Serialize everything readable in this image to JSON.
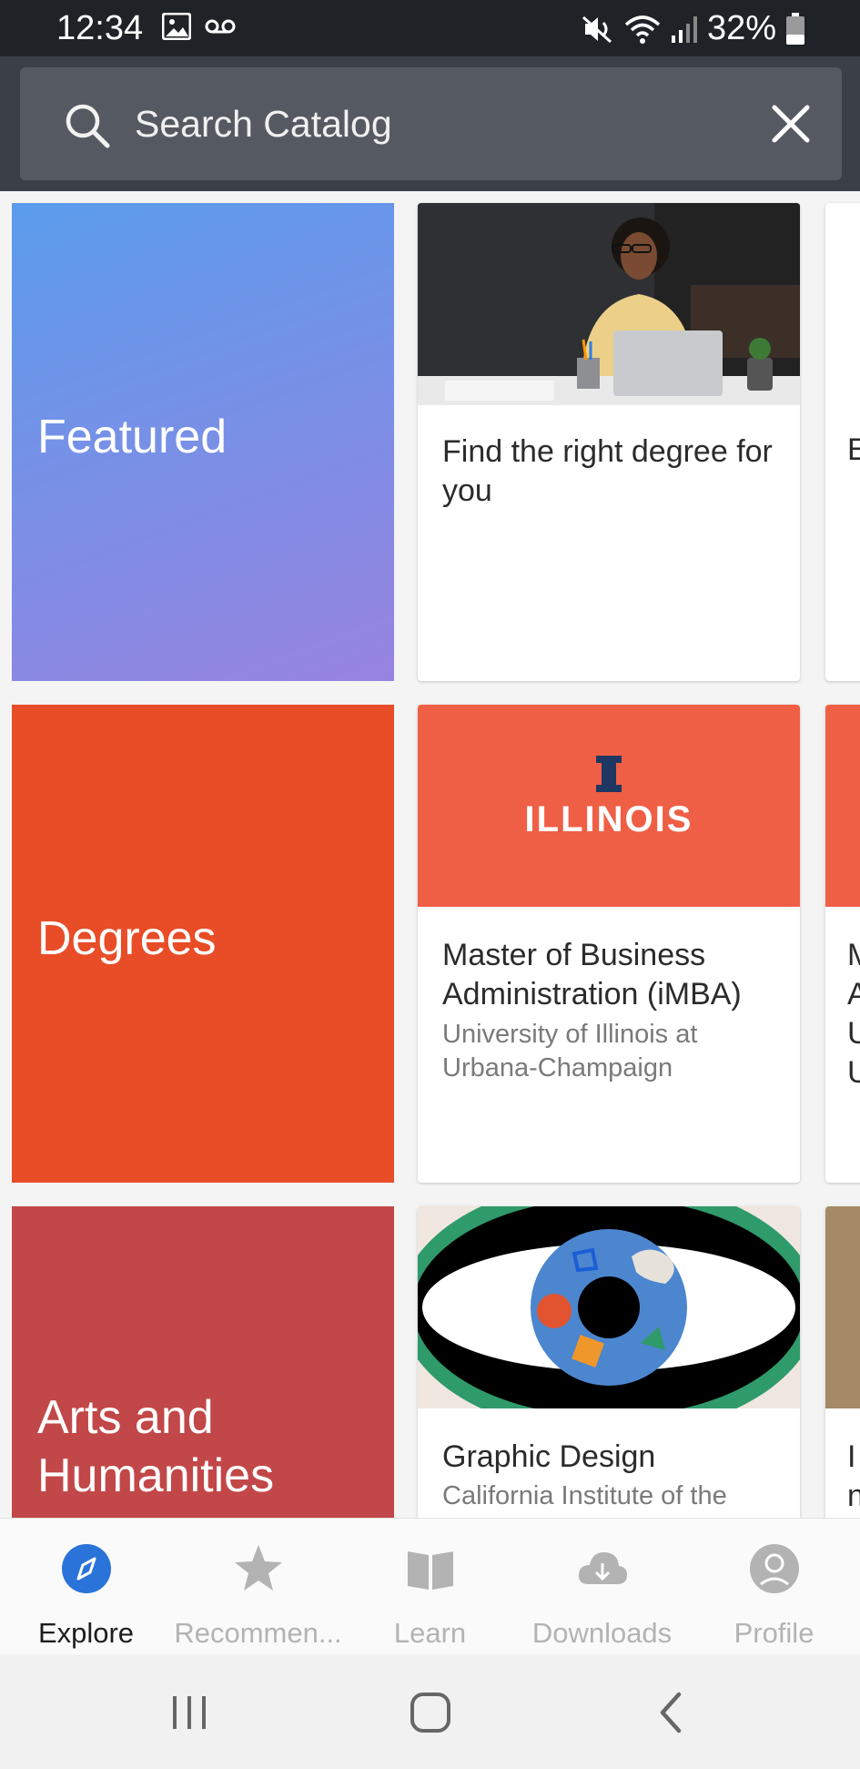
{
  "status_bar": {
    "time": "12:34",
    "battery": "32%",
    "icons": [
      "image-icon",
      "voicemail-icon",
      "mute-icon",
      "wifi-icon",
      "signal-icon",
      "battery-icon"
    ]
  },
  "search": {
    "placeholder": "Search Catalog",
    "value": ""
  },
  "catalog": {
    "rows": [
      {
        "category": "Featured",
        "category_colors": [
          "#5b9cec",
          "#9783e0"
        ],
        "card": {
          "title": "Find the right degree for you",
          "subtitle": "",
          "image": "woman-at-laptop-photo"
        },
        "peek_text": "E"
      },
      {
        "category": "Degrees",
        "category_colors": [
          "#e84d28",
          "#e84d28"
        ],
        "card": {
          "title": "Master of Business Administration (iMBA)",
          "subtitle": "University of Illinois at Urbana-Champaign",
          "image": "illinois-logo",
          "logo_text": "ILLINOIS"
        },
        "peek_text": "M A U U"
      },
      {
        "category": "Arts and Humanities",
        "category_colors": [
          "#c24748",
          "#c24748"
        ],
        "card": {
          "title": "Graphic Design",
          "subtitle": "California Institute of the Arts",
          "image": "eye-graphic"
        },
        "peek_text": "In P"
      }
    ]
  },
  "bottom_nav": {
    "items": [
      {
        "label": "Explore",
        "icon": "compass-icon",
        "active": true
      },
      {
        "label": "Recommen...",
        "icon": "star-icon",
        "active": false
      },
      {
        "label": "Learn",
        "icon": "book-icon",
        "active": false
      },
      {
        "label": "Downloads",
        "icon": "cloud-download-icon",
        "active": false
      },
      {
        "label": "Profile",
        "icon": "profile-icon",
        "active": false
      }
    ],
    "active_color": "#2a73d8"
  },
  "system_nav": {
    "buttons": [
      "recent-apps-icon",
      "home-icon",
      "back-icon"
    ]
  }
}
